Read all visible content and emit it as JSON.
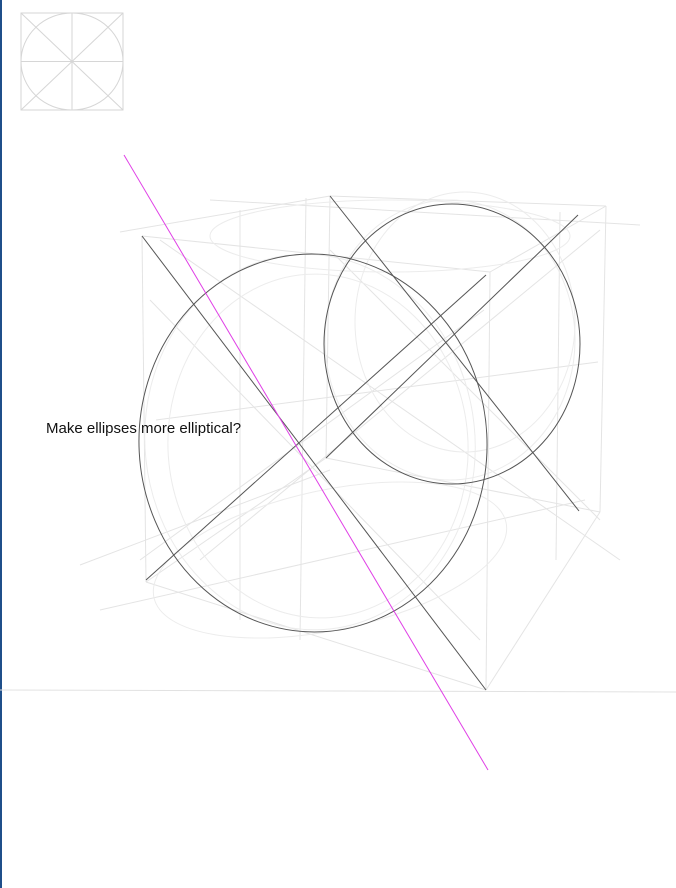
{
  "annotation": {
    "text": "Make ellipses more elliptical?"
  },
  "colors": {
    "construction": "#d9d9d9",
    "construction_faint": "#e9e9e9",
    "ink": "#555555",
    "guide": "#e040e6",
    "edge": "#1f4f8a",
    "background": "#ffffff"
  }
}
